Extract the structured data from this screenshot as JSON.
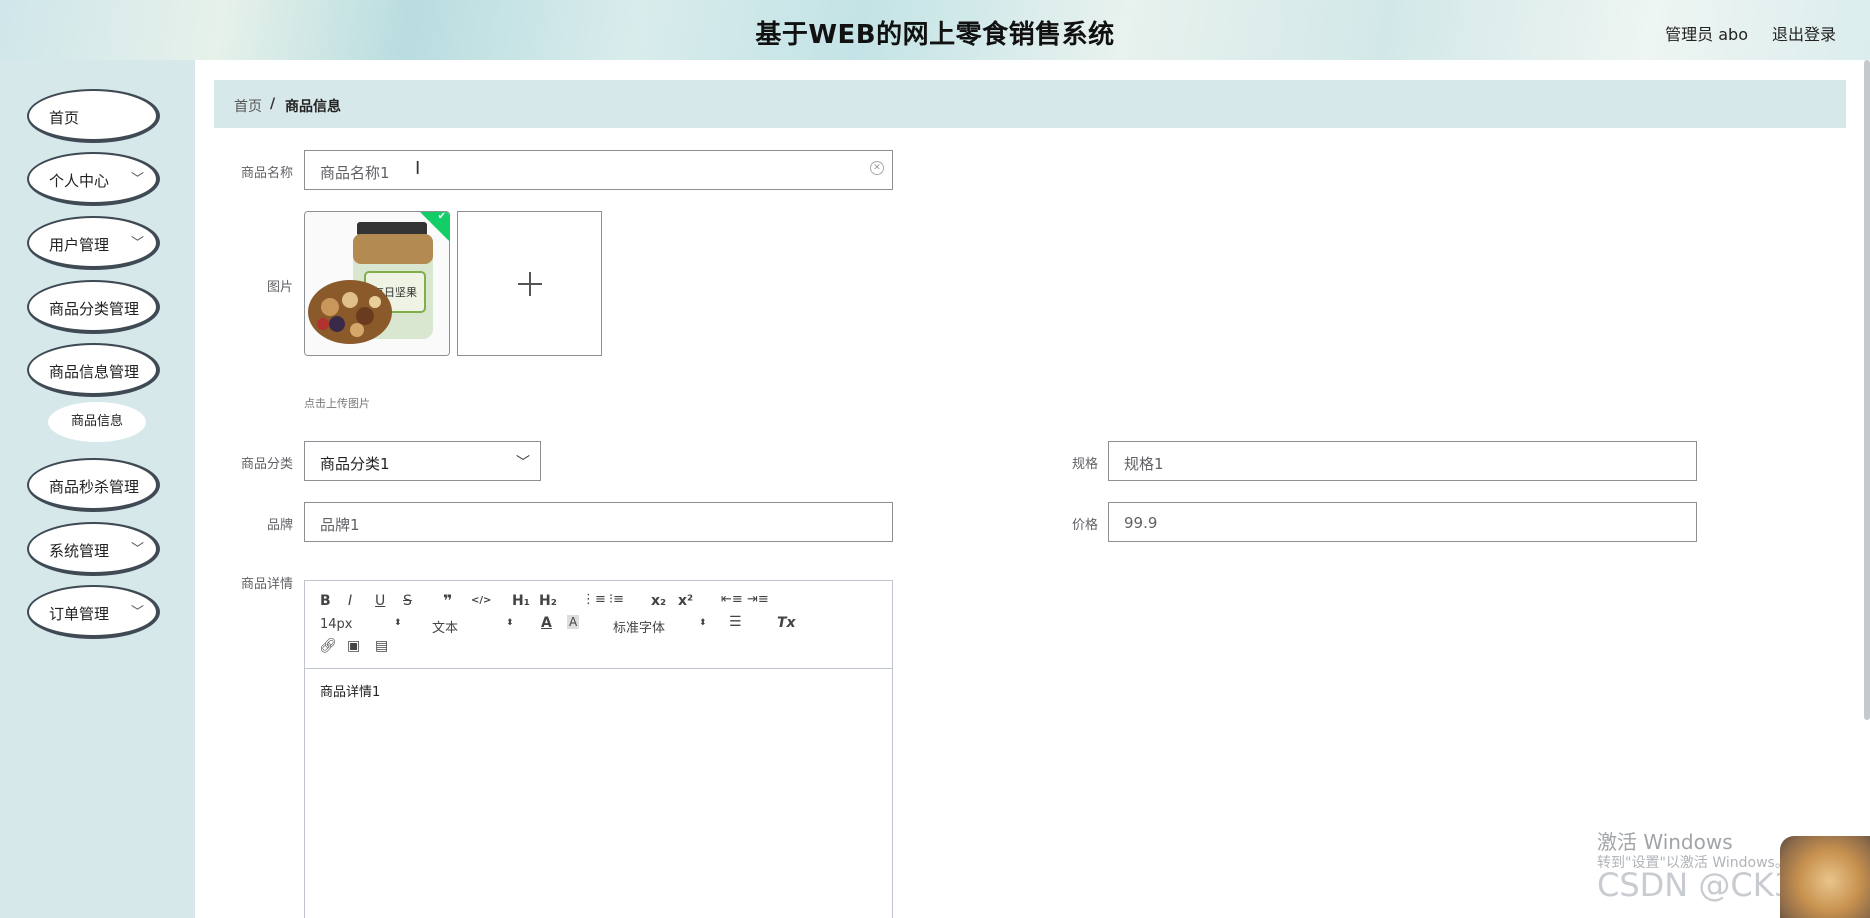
{
  "header": {
    "title": "基于WEB的网上零食销售系统",
    "user": "管理员 abo",
    "logout": "退出登录"
  },
  "sidebar": {
    "items": [
      {
        "label": "首页",
        "has_arrow": false
      },
      {
        "label": "个人中心",
        "has_arrow": true
      },
      {
        "label": "用户管理",
        "has_arrow": true
      },
      {
        "label": "商品分类管理",
        "has_arrow": false
      },
      {
        "label": "商品信息管理",
        "has_arrow": false
      },
      {
        "label": "商品秒杀管理",
        "has_arrow": false
      },
      {
        "label": "系统管理",
        "has_arrow": true
      },
      {
        "label": "订单管理",
        "has_arrow": true
      }
    ],
    "sub_items": [
      {
        "label": "商品信息"
      }
    ]
  },
  "breadcrumb": {
    "home": "首页",
    "separator": "/",
    "current": "商品信息"
  },
  "form": {
    "name": {
      "label": "商品名称",
      "value": "商品名称1"
    },
    "image": {
      "label": "图片",
      "tip": "点击上传图片",
      "product_text": "每日坚果"
    },
    "category": {
      "label": "商品分类",
      "value": "商品分类1"
    },
    "spec": {
      "label": "规格",
      "value": "规格1"
    },
    "brand": {
      "label": "品牌",
      "value": "品牌1"
    },
    "price": {
      "label": "价格",
      "value": "99.9"
    },
    "detail": {
      "label": "商品详情",
      "content": "商品详情1"
    }
  },
  "editor": {
    "font_size": "14px",
    "header_select": "文本",
    "font_family": "标准字体",
    "buttons": {
      "bold": "B",
      "italic": "I",
      "underline": "U",
      "strike": "S",
      "quote": "❞",
      "code": "</>",
      "h1": "H₁",
      "h2": "H₂",
      "sub": "x₂",
      "sup": "x²",
      "clean": "Tx"
    }
  },
  "watermark": {
    "activate_title": "激活 Windows",
    "activate_hint": "转到\"设置\"以激活 Windows。",
    "csdn": "CSDN @CK3011"
  },
  "colors": {
    "sidebar_bg": "#d7e8eb",
    "menu_border": "#3f4a54",
    "success": "#13ce66"
  }
}
